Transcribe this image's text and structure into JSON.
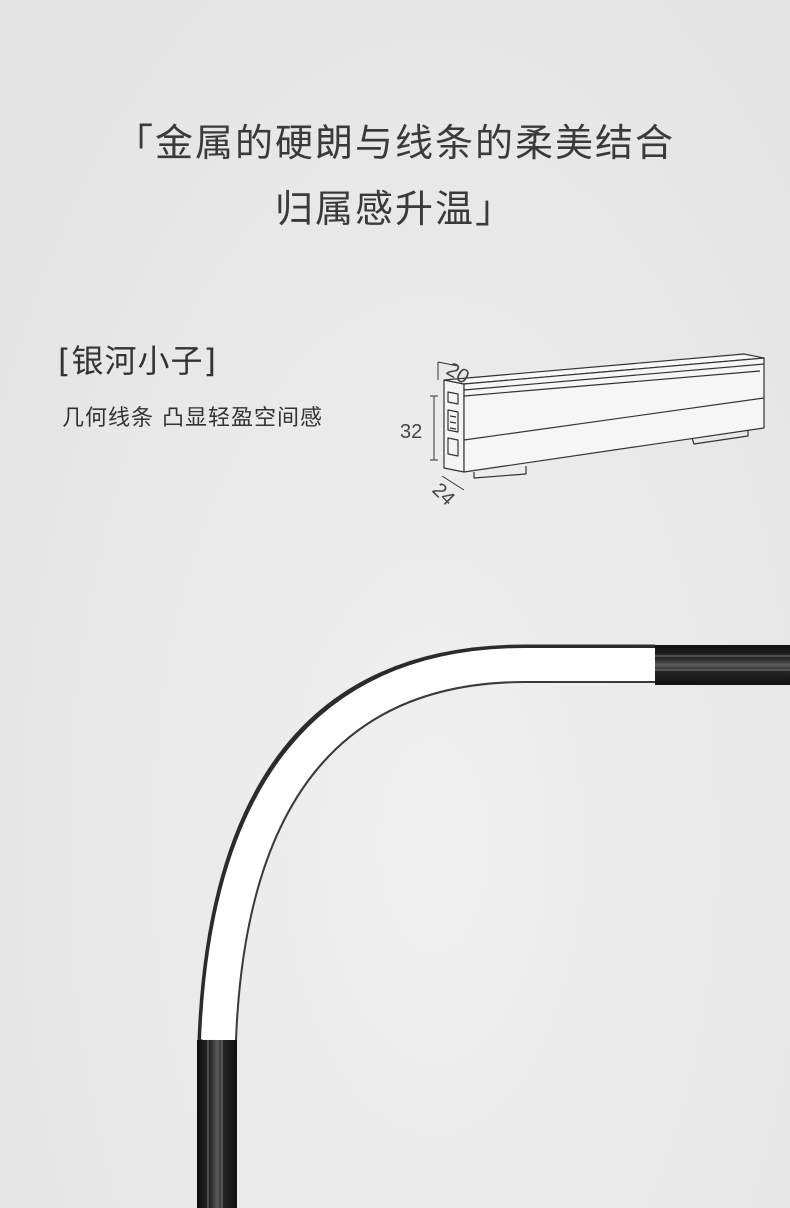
{
  "headline": {
    "line1": "「金属的硬朗与线条的柔美结合",
    "line2": "归属感升温」"
  },
  "product": {
    "name": "[银河小子]",
    "description": "几何线条 凸显轻盈空间感"
  },
  "dimensions": {
    "top": "20",
    "height": "32",
    "depth": "24"
  },
  "colors": {
    "background": "#e9e9e9",
    "text": "#333333",
    "track_black": "#1c1c1c",
    "track_white": "#ffffff"
  }
}
